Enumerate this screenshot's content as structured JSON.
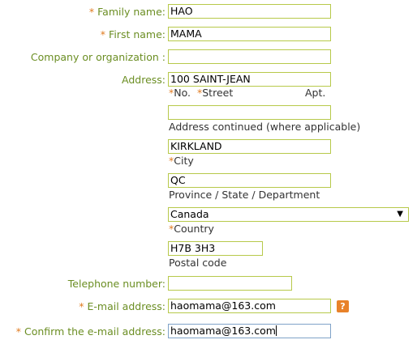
{
  "labels": {
    "family_name": "Family name:",
    "first_name": "First name:",
    "company": "Company or organization :",
    "address": "Address:",
    "telephone": "Telephone number:",
    "email": "E-mail address:",
    "confirm_email": "Confirm the e-mail address:"
  },
  "required_marker": "*",
  "values": {
    "family_name": "HAO",
    "first_name": "MAMA",
    "company": "",
    "address": "100 SAINT-JEAN",
    "address_continued": "",
    "city": "KIRKLAND",
    "province": "QC",
    "country": "Canada",
    "postal_code": "H7B 3H3",
    "telephone": "",
    "email": "haomama@163.com",
    "confirm_email": "haomama@163.com"
  },
  "sublabels": {
    "no": "No.",
    "street": "Street",
    "apt": "Apt.",
    "address_continued": "Address continued (where applicable)",
    "city": "City",
    "province": "Province / State / Department",
    "country": "Country",
    "postal_code": "Postal code"
  },
  "help_icon": "?"
}
